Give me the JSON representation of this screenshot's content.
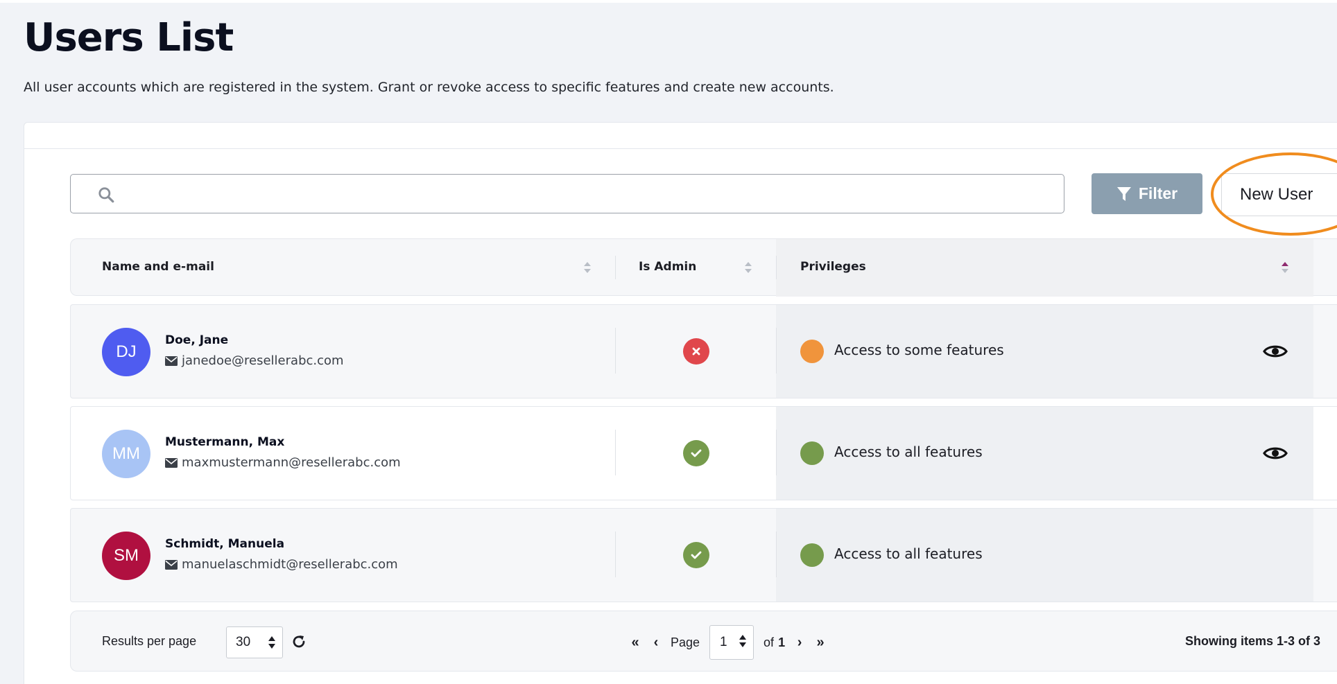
{
  "page": {
    "title": "Users List",
    "subtitle": "All user accounts which are registered in the system. Grant or revoke access to specific features and create new accounts."
  },
  "toolbar": {
    "search_placeholder": "",
    "search_value": "",
    "filter_label": "Filter",
    "new_user_label": "New User"
  },
  "table": {
    "columns": [
      {
        "label": "Name and e-mail",
        "sort": "none"
      },
      {
        "label": "Is Admin",
        "sort": "none"
      },
      {
        "label": "Privileges",
        "sort": "ascending"
      }
    ],
    "rows": [
      {
        "initials": "DJ",
        "avatar_color": "#4f5cf0",
        "name": "Doe, Jane",
        "email": "janedoe@resellerabc.com",
        "is_admin": false,
        "privilege_status_color": "#f0943c",
        "privileges": "Access to some features",
        "has_view_action": true
      },
      {
        "initials": "MM",
        "avatar_color": "#a8c4f5",
        "name": "Mustermann, Max",
        "email": "maxmustermann@resellerabc.com",
        "is_admin": true,
        "privilege_status_color": "#769b4c",
        "privileges": "Access to all features",
        "has_view_action": true
      },
      {
        "initials": "SM",
        "avatar_color": "#b01040",
        "name": "Schmidt, Manuela",
        "email": "manuelaschmidt@resellerabc.com",
        "is_admin": true,
        "privilege_status_color": "#769b4c",
        "privileges": "Access to all features",
        "has_view_action": false
      }
    ]
  },
  "pagination": {
    "results_per_page_label": "Results per page",
    "results_per_page": "30",
    "page_label": "Page",
    "current_page": "1",
    "of_label": "of",
    "total_pages": "1",
    "showing": "Showing items 1-3 of 3"
  },
  "colors": {
    "admin_yes": "#769b4c",
    "admin_no": "#e0474c",
    "filter_button": "#8b9faf",
    "highlight": "#f08c1e",
    "sort_active": "#8e2a6e",
    "sort_inactive": "#b9bec6"
  },
  "icons": {
    "search": "search-icon",
    "filter": "filter-icon",
    "email": "envelope-icon",
    "view": "eye-icon",
    "reload": "refresh-icon",
    "first_page": "double-chevron-left-icon",
    "prev_page": "chevron-left-icon",
    "next_page": "chevron-right-icon",
    "last_page": "double-chevron-right-icon"
  }
}
